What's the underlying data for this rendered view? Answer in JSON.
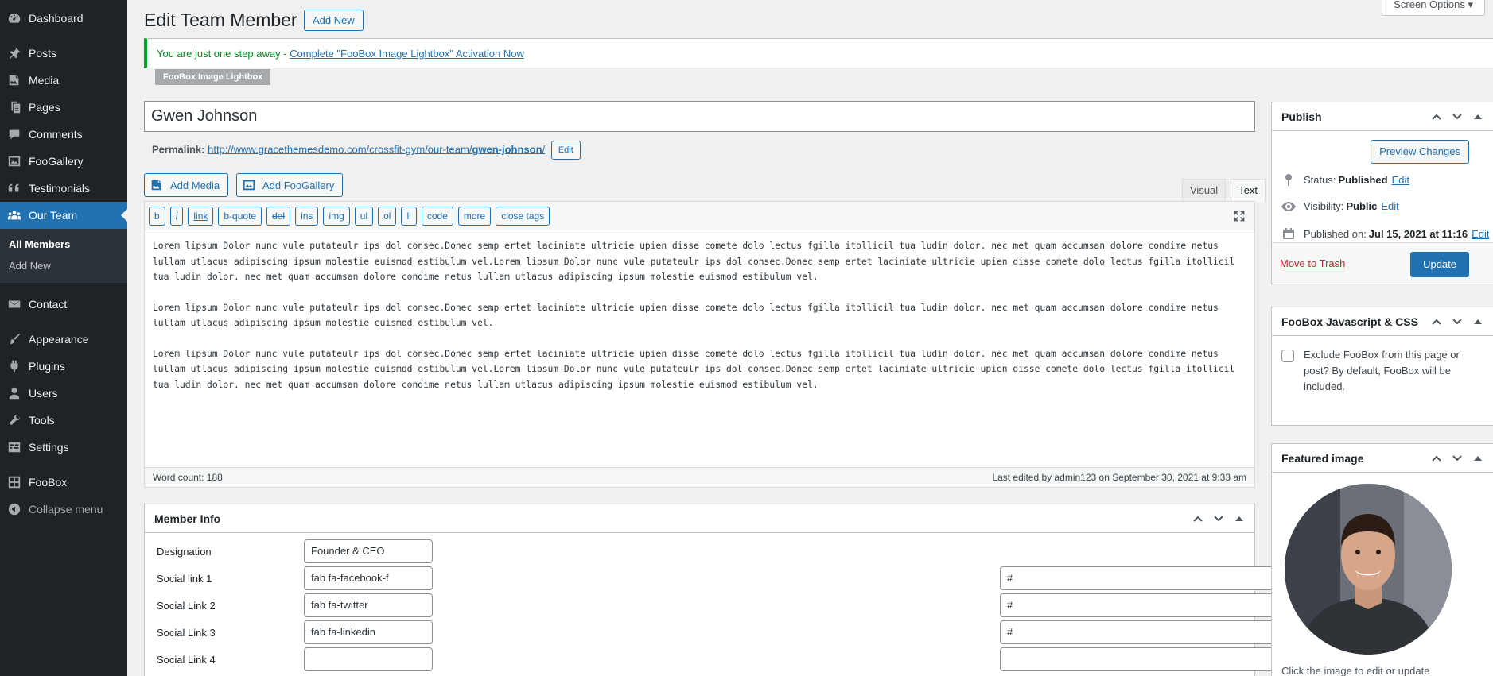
{
  "sidebar": {
    "items": [
      {
        "label": "Dashboard",
        "icon": "dashboard-icon"
      },
      {
        "label": "Posts",
        "icon": "pin-icon"
      },
      {
        "label": "Media",
        "icon": "media-icon"
      },
      {
        "label": "Pages",
        "icon": "pages-icon"
      },
      {
        "label": "Comments",
        "icon": "comments-icon"
      },
      {
        "label": "FooGallery",
        "icon": "gallery-icon"
      },
      {
        "label": "Testimonials",
        "icon": "quote-icon"
      },
      {
        "label": "Our Team",
        "icon": "team-icon"
      },
      {
        "label": "Contact",
        "icon": "email-icon"
      },
      {
        "label": "Appearance",
        "icon": "brush-icon"
      },
      {
        "label": "Plugins",
        "icon": "plugin-icon"
      },
      {
        "label": "Users",
        "icon": "user-icon"
      },
      {
        "label": "Tools",
        "icon": "wrench-icon"
      },
      {
        "label": "Settings",
        "icon": "settings-icon"
      },
      {
        "label": "FooBox",
        "icon": "grid-icon"
      },
      {
        "label": "Collapse menu",
        "icon": "collapse-icon"
      }
    ],
    "submenu": [
      "All Members",
      "Add New"
    ]
  },
  "header": {
    "screen_options": "Screen Options",
    "title": "Edit Team Member",
    "add_new": "Add New"
  },
  "notice": {
    "prefix": "You are just one step away - ",
    "link": "Complete \"FooBox Image Lightbox\" Activation Now",
    "tab": "FooBox Image Lightbox"
  },
  "post": {
    "title": "Gwen Johnson",
    "permalink_label": "Permalink:",
    "permalink_base": "http://www.gracethemesdemo.com/crossfit-gym/our-team/",
    "permalink_slug": "gwen-johnson",
    "permalink_trail": "/",
    "edit": "Edit"
  },
  "editor": {
    "add_media": "Add Media",
    "add_foogallery": "Add FooGallery",
    "tab_visual": "Visual",
    "tab_text": "Text",
    "toolbar": [
      "b",
      "i",
      "link",
      "b-quote",
      "del",
      "ins",
      "img",
      "ul",
      "ol",
      "li",
      "code",
      "more",
      "close tags"
    ],
    "paragraphs": [
      "Lorem lipsum Dolor nunc vule putateulr ips dol consec.Donec semp ertet laciniate ultricie upien disse comete dolo lectus fgilla itollicil tua ludin dolor. nec met quam accumsan dolore condime netus lullam utlacus adipiscing ipsum molestie euismod estibulum vel.Lorem lipsum Dolor nunc vule putateulr ips dol consec.Donec semp ertet laciniate ultricie upien disse comete dolo lectus fgilla itollicil tua ludin dolor. nec met quam accumsan dolore condime netus lullam utlacus adipiscing ipsum molestie euismod estibulum vel.",
      "Lorem lipsum Dolor nunc vule putateulr ips dol consec.Donec semp ertet laciniate ultricie upien disse comete dolo lectus fgilla itollicil tua ludin dolor. nec met quam accumsan dolore condime netus lullam utlacus adipiscing ipsum molestie euismod estibulum vel.",
      "Lorem lipsum Dolor nunc vule putateulr ips dol consec.Donec semp ertet laciniate ultricie upien disse comete dolo lectus fgilla itollicil tua ludin dolor. nec met quam accumsan dolore condime netus lullam utlacus adipiscing ipsum molestie euismod estibulum vel.Lorem lipsum Dolor nunc vule putateulr ips dol consec.Donec semp ertet laciniate ultricie upien disse comete dolo lectus fgilla itollicil tua ludin dolor. nec met quam accumsan dolore condime netus lullam utlacus adipiscing ipsum molestie euismod estibulum vel."
    ],
    "word_count": "Word count: 188",
    "last_edited": "Last edited by admin123 on September 30, 2021 at 9:33 am"
  },
  "member_info": {
    "title": "Member Info",
    "rows": [
      {
        "label": "Designation",
        "value": "Founder & CEO",
        "link": null
      },
      {
        "label": "Social link 1",
        "value": "fab fa-facebook-f",
        "link": "#"
      },
      {
        "label": "Social Link 2",
        "value": "fab fa-twitter",
        "link": "#"
      },
      {
        "label": "Social Link 3",
        "value": "fab fa-linkedin",
        "link": "#"
      },
      {
        "label": "Social Link 4",
        "value": "",
        "link": ""
      }
    ]
  },
  "publish": {
    "title": "Publish",
    "preview": "Preview Changes",
    "status_label": "Status:",
    "status_value": "Published",
    "visibility_label": "Visibility:",
    "visibility_value": "Public",
    "published_label": "Published on:",
    "published_value": "Jul 15, 2021 at 11:16",
    "edit": "Edit",
    "trash": "Move to Trash",
    "update": "Update"
  },
  "foobox_js": {
    "title": "FooBox Javascript & CSS",
    "text": "Exclude FooBox from this page or post? By default, FooBox will be included."
  },
  "featured": {
    "title": "Featured image",
    "caption": "Click the image to edit or update"
  },
  "colors": {
    "accent": "#2271b1",
    "sidebar": "#1d2327",
    "notice_border": "#00a32a",
    "trash": "#b32d2e"
  }
}
